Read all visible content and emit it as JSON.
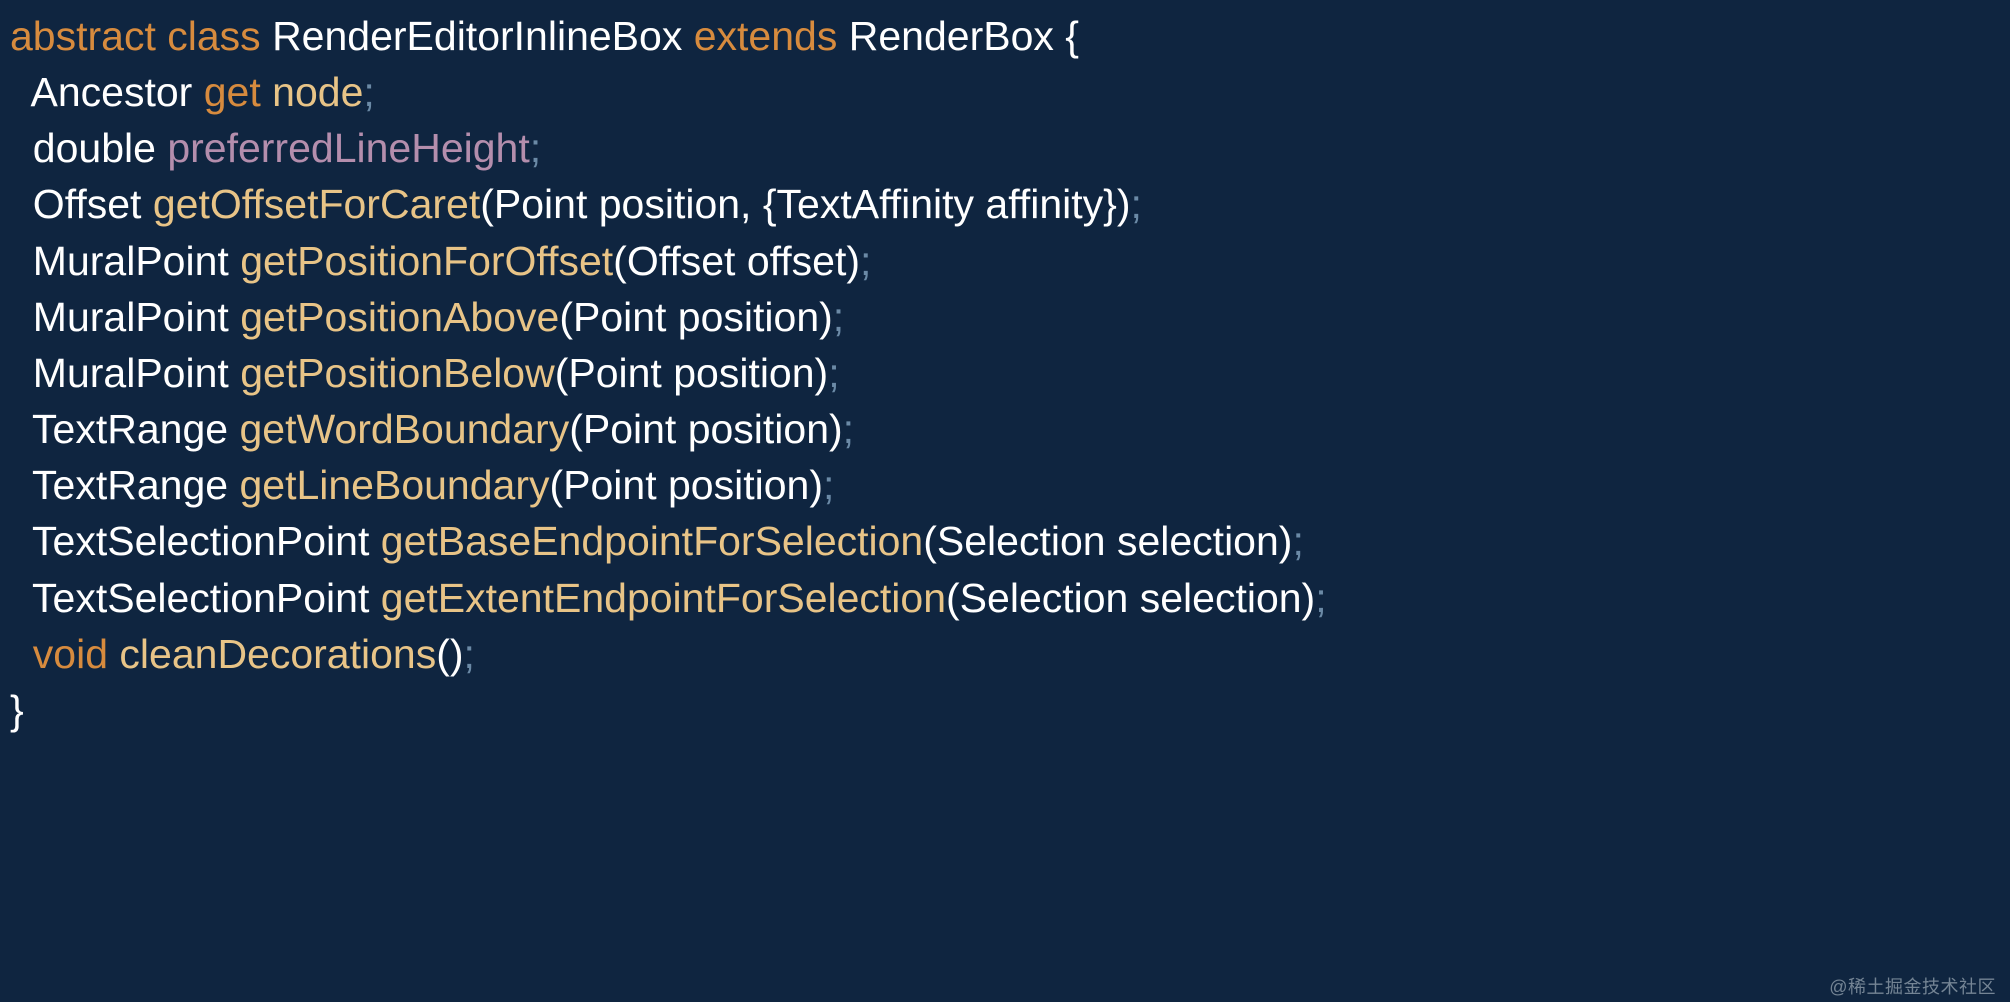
{
  "watermark": "@稀土掘金技术社区",
  "code": {
    "l1": {
      "kw1": "abstract",
      "kw2": "class",
      "className": "RenderEditorInlineBox",
      "kw3": "extends",
      "superClass": "RenderBox",
      "open": "{"
    },
    "l2": {
      "type": "Ancestor",
      "kw": "get",
      "name": "node",
      "sc": ";"
    },
    "l3": {
      "type": "double",
      "name": "preferredLineHeight",
      "sc": ";"
    },
    "l4": {
      "type": "Offset",
      "name": "getOffsetForCaret",
      "params": "(Point position, {TextAffinity affinity})",
      "sc": ";"
    },
    "l5": {
      "type": "MuralPoint",
      "name": "getPositionForOffset",
      "params": "(Offset offset)",
      "sc": ";"
    },
    "l6": {
      "type": "MuralPoint",
      "name": "getPositionAbove",
      "params": "(Point position)",
      "sc": ";"
    },
    "l7": {
      "type": "MuralPoint",
      "name": "getPositionBelow",
      "params": "(Point position)",
      "sc": ";"
    },
    "l8": {
      "type": "TextRange",
      "name": "getWordBoundary",
      "params": "(Point position)",
      "sc": ";"
    },
    "l9": {
      "type": "TextRange",
      "name": "getLineBoundary",
      "params": "(Point position)",
      "sc": ";"
    },
    "l10": {
      "type": "TextSelectionPoint",
      "name": "getBaseEndpointForSelection",
      "params": "(Selection selection)",
      "sc": ";"
    },
    "l11": {
      "type": "TextSelectionPoint",
      "name": "getExtentEndpointForSelection",
      "params": "(Selection selection)",
      "sc": ";"
    },
    "l12": {
      "kw": "void",
      "name": "cleanDecorations",
      "params": "()",
      "sc": ";"
    },
    "l13": {
      "close": "}"
    }
  }
}
